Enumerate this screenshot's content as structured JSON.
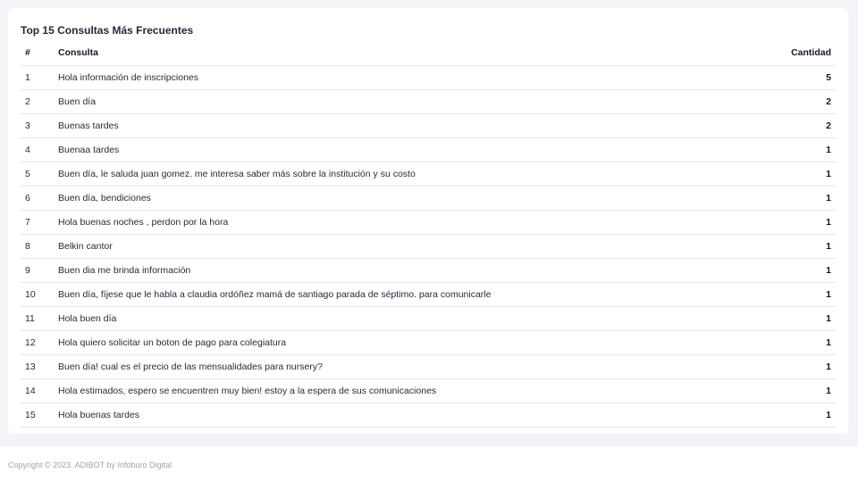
{
  "card": {
    "title": "Top 15 Consultas Más Frecuentes",
    "columns": {
      "num": "#",
      "query": "Consulta",
      "count": "Cantidad"
    },
    "rows": [
      {
        "num": "1",
        "query": "Hola información de inscripciones",
        "count": "5"
      },
      {
        "num": "2",
        "query": "Buen día",
        "count": "2"
      },
      {
        "num": "3",
        "query": "Buenas tardes",
        "count": "2"
      },
      {
        "num": "4",
        "query": "Buenaa tardes",
        "count": "1"
      },
      {
        "num": "5",
        "query": "Buen día, le saluda juan gomez. me interesa saber más sobre la institución y su costo",
        "count": "1"
      },
      {
        "num": "6",
        "query": "Buen día, bendiciones",
        "count": "1"
      },
      {
        "num": "7",
        "query": "Hola buenas noches , perdon por la hora",
        "count": "1"
      },
      {
        "num": "8",
        "query": "Belkin cantor",
        "count": "1"
      },
      {
        "num": "9",
        "query": "Buen dia me brinda información",
        "count": "1"
      },
      {
        "num": "10",
        "query": "Buen día, fíjese que le habla a claudia ordóñez mamá de santiago parada de séptimo. para comunicarle",
        "count": "1"
      },
      {
        "num": "11",
        "query": "Hola buen día",
        "count": "1"
      },
      {
        "num": "12",
        "query": "Hola quiero solicitar un boton de pago para colegiatura",
        "count": "1"
      },
      {
        "num": "13",
        "query": "Buen día! cual es el precio de las mensualidades para nursery?",
        "count": "1"
      },
      {
        "num": "14",
        "query": "Hola estimados, espero se encuentren muy bien! estoy a la espera de sus comunicaciones",
        "count": "1"
      },
      {
        "num": "15",
        "query": "Hola buenas tardes",
        "count": "1"
      }
    ]
  },
  "footer": {
    "copyright": "Copyright © 2023. ADIBOT by Infoburo Digital"
  }
}
